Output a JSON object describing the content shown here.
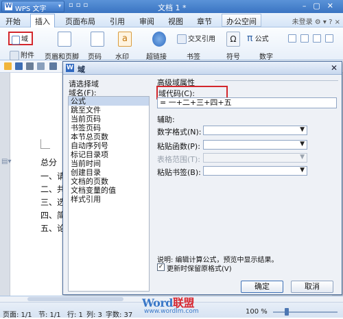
{
  "app": {
    "menu_label": "WPS 文字",
    "doc_title": "文档 1 *"
  },
  "menu_tabs": [
    "开始",
    "插入",
    "页面布局",
    "引用",
    "审阅",
    "视图",
    "章节",
    "办公空间"
  ],
  "login": "未登录",
  "ribbon": {
    "domain": "域",
    "attach": "附件",
    "header_footer": "页眉和页脚",
    "page_num": "页码",
    "watermark": "水印",
    "hyperlink": "超链接",
    "bookmark": "书签",
    "cross_ref": "交叉引用",
    "symbol": "符号",
    "formula": "公式",
    "number": "数字"
  },
  "document": {
    "lines": [
      "总分",
      "一、请",
      "二、共",
      "三、选",
      "四、简",
      "五、论"
    ]
  },
  "dialog": {
    "title": "域",
    "close": "✕",
    "choose_label": "请选择域",
    "field_name_label": "域名(F):",
    "fields": [
      "公式",
      "跳至文件",
      "当前页码",
      "书签页码",
      "本节总页数",
      "自动序列号",
      "标记目录项",
      "当前时间",
      "创建目录",
      "文档的页数",
      "文档变量的值",
      "样式引用"
    ],
    "selected_field": "公式",
    "advanced_label": "高级域属性",
    "code_label": "域代码(C):",
    "code_value": "= 一+二+三+四+五",
    "aux_label": "辅助:",
    "number_format_label": "数字格式(N):",
    "paste_func_label": "粘贴函数(P):",
    "table_range_label": "表格范围(T):",
    "paste_bookmark_label": "粘贴书签(B):",
    "description": "说明: 编辑计算公式，预览中显示结果。",
    "preserve_label": "更新时保留原格式(V)",
    "preserve_checked": true,
    "ok": "确定",
    "cancel": "取消"
  },
  "status": {
    "page": "页面: 1/1",
    "section": "节: 1/1",
    "row": "行: 1",
    "col": "列: 3",
    "chars": "字数: 37",
    "zoom": "100 %",
    "zoom_level": 1.0
  },
  "watermark": {
    "part1": "Word",
    "part2": "联盟",
    "url": "www.wordlm.com"
  }
}
